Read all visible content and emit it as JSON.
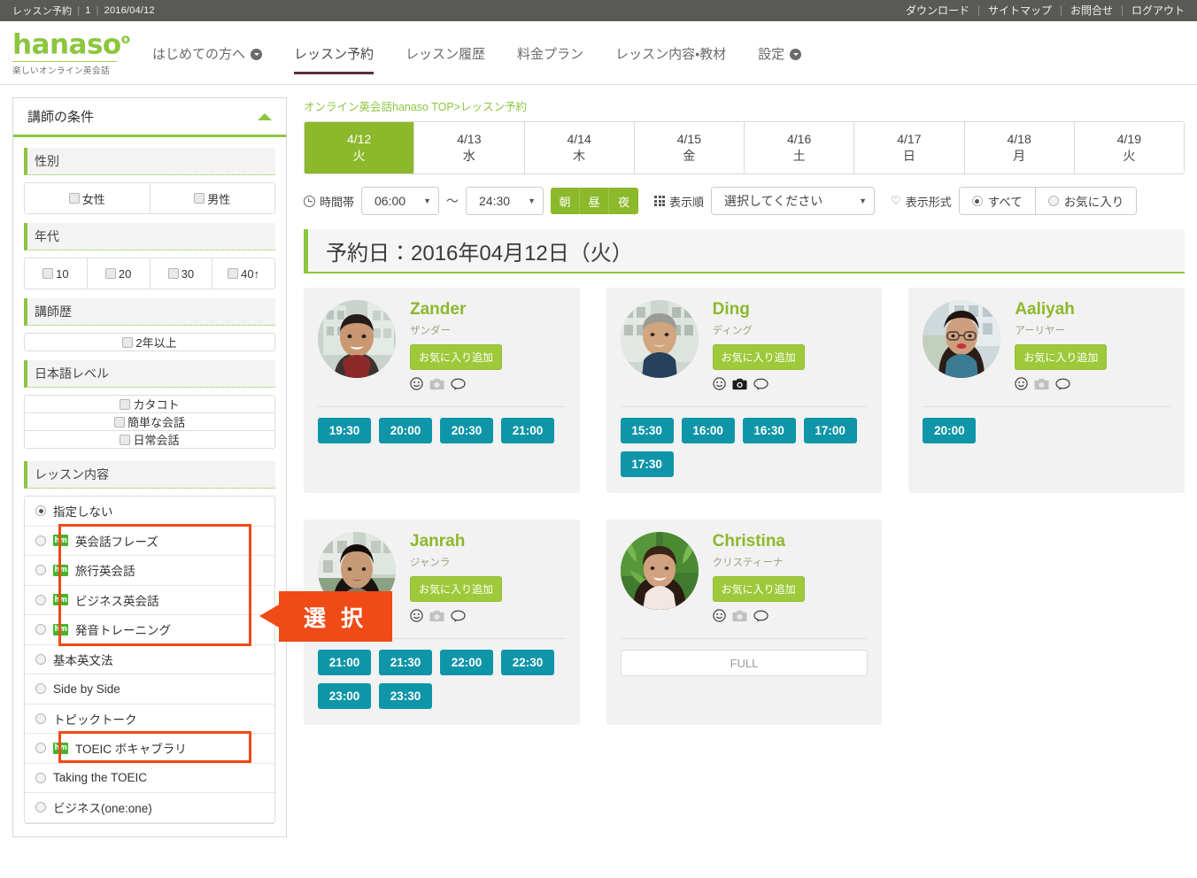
{
  "utility_bar": {
    "left_items": [
      "レッスン予約",
      "1",
      "2016/04/12"
    ],
    "links": [
      "ダウンロード",
      "サイトマップ",
      "お問合せ",
      "ログアウト"
    ]
  },
  "header": {
    "logo_text": "hanaso",
    "logo_degree": "o",
    "logo_tagline": "楽しいオンライン英会話",
    "nav": [
      {
        "label": "はじめての方へ",
        "has_caret": true,
        "active": false
      },
      {
        "label": "レッスン予約",
        "has_caret": false,
        "active": true
      },
      {
        "label": "レッスン履歴",
        "has_caret": false,
        "active": false
      },
      {
        "label": "料金プラン",
        "has_caret": false,
        "active": false
      },
      {
        "label": "レッスン内容・教材",
        "has_caret": false,
        "active": false
      },
      {
        "label": "設定",
        "has_caret": true,
        "active": false
      }
    ]
  },
  "sidebar": {
    "panel_title": "講師の条件",
    "sections": [
      {
        "title": "性別",
        "type": "checkbox-row",
        "options": [
          "女性",
          "男性"
        ]
      },
      {
        "title": "年代",
        "type": "checkbox-row",
        "options": [
          "10",
          "20",
          "30",
          "40↑"
        ]
      },
      {
        "title": "講師歴",
        "type": "checkbox-stack",
        "options": [
          "2年以上"
        ]
      },
      {
        "title": "日本語レベル",
        "type": "checkbox-stack",
        "options": [
          "カタコト",
          "簡単な会話",
          "日常会話"
        ]
      }
    ],
    "lesson_section_title": "レッスン内容",
    "lesson_options": [
      {
        "label": "指定しない",
        "badge": false,
        "selected": true
      },
      {
        "label": "英会話フレーズ",
        "badge": true,
        "selected": false
      },
      {
        "label": "旅行英会話",
        "badge": true,
        "selected": false
      },
      {
        "label": "ビジネス英会話",
        "badge": true,
        "selected": false
      },
      {
        "label": "発音トレーニング",
        "badge": true,
        "selected": false
      },
      {
        "label": "基本英文法",
        "badge": false,
        "selected": false
      },
      {
        "label": "Side by Side",
        "badge": false,
        "selected": false
      },
      {
        "label": "トピックトーク",
        "badge": false,
        "selected": false
      },
      {
        "label": "TOEIC ボキャブラリ",
        "badge": true,
        "selected": false
      },
      {
        "label": "Taking the TOEIC",
        "badge": false,
        "selected": false
      },
      {
        "label": "ビジネス(one:one)",
        "badge": false,
        "selected": false
      }
    ],
    "badge_text": "hm"
  },
  "main": {
    "breadcrumb_link": "オンライン英会話hanaso TOP",
    "breadcrumb_current": ">レッスン予約",
    "date_tabs": [
      {
        "date": "4/12",
        "day": "火",
        "active": true
      },
      {
        "date": "4/13",
        "day": "水",
        "active": false
      },
      {
        "date": "4/14",
        "day": "木",
        "active": false
      },
      {
        "date": "4/15",
        "day": "金",
        "active": false
      },
      {
        "date": "4/16",
        "day": "土",
        "active": false
      },
      {
        "date": "4/17",
        "day": "日",
        "active": false
      },
      {
        "date": "4/18",
        "day": "月",
        "active": false
      },
      {
        "date": "4/19",
        "day": "火",
        "active": false
      }
    ],
    "toolbar": {
      "time_label": "時間帯",
      "time_from": "06:00",
      "time_to": "24:30",
      "tilde": "〜",
      "segments": [
        "朝",
        "昼",
        "夜"
      ],
      "order_label": "表示順",
      "order_value": "選択してください",
      "display_label": "表示形式",
      "display_options": [
        {
          "label": "すべて",
          "selected": true
        },
        {
          "label": "お気に入り",
          "selected": false
        }
      ]
    },
    "day_banner": "予約日：2016年04月12日（火）",
    "teachers": [
      {
        "name": "Zander",
        "kana": "ザンダー",
        "fav_label": "お気に入り追加",
        "camera_active": false,
        "avatar": "male-young",
        "slots": [
          "19:30",
          "20:00",
          "20:30",
          "21:00"
        ],
        "full": false
      },
      {
        "name": "Ding",
        "kana": "ディング",
        "fav_label": "お気に入り追加",
        "camera_active": true,
        "avatar": "male-old",
        "slots": [
          "15:30",
          "16:00",
          "16:30",
          "17:00",
          "17:30"
        ],
        "full": false
      },
      {
        "name": "Aaliyah",
        "kana": "アーリヤー",
        "fav_label": "お気に入り追加",
        "camera_active": false,
        "avatar": "female-glasses",
        "slots": [
          "20:00"
        ],
        "full": false
      },
      {
        "name": "Janrah",
        "kana": "ジャンラ",
        "fav_label": "お気に入り追加",
        "camera_active": false,
        "avatar": "female-young",
        "slots": [
          "21:00",
          "21:30",
          "22:00",
          "22:30",
          "23:00",
          "23:30"
        ],
        "full": false
      },
      {
        "name": "Christina",
        "kana": "クリスティーナ",
        "fav_label": "お気に入り追加",
        "camera_active": false,
        "avatar": "female-green",
        "slots": [],
        "full": true,
        "full_label": "FULL"
      }
    ]
  },
  "annotation": {
    "callout_text": "選 択"
  },
  "colors": {
    "brand_green": "#8cc63e",
    "tab_green": "#8cb82b",
    "slot_teal": "#0e95a8",
    "annotation_orange": "#f04a16",
    "utility_gray": "#595a56",
    "nav_underline": "#5d2c40"
  }
}
